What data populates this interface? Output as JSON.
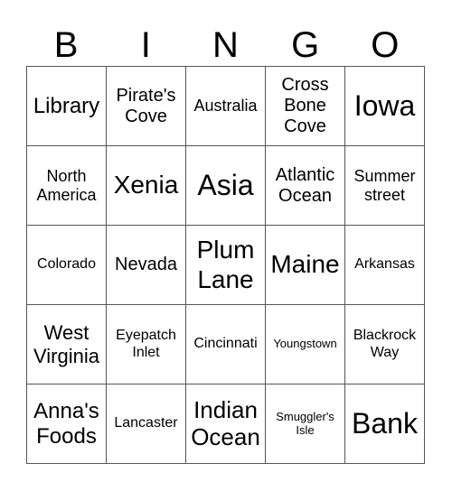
{
  "header": [
    "B",
    "I",
    "N",
    "G",
    "O"
  ],
  "cells": [
    {
      "text": "Library",
      "size": "s24"
    },
    {
      "text": "Pirate's\nCove",
      "size": "s20"
    },
    {
      "text": "Australia",
      "size": "s18"
    },
    {
      "text": "Cross\nBone\nCove",
      "size": "s20"
    },
    {
      "text": "Iowa",
      "size": "s32"
    },
    {
      "text": "North\nAmerica",
      "size": "s18"
    },
    {
      "text": "Xenia",
      "size": "s28"
    },
    {
      "text": "Asia",
      "size": "s32"
    },
    {
      "text": "Atlantic\nOcean",
      "size": "s20"
    },
    {
      "text": "Summer\nstreet",
      "size": "s18"
    },
    {
      "text": "Colorado",
      "size": "s16"
    },
    {
      "text": "Nevada",
      "size": "s20"
    },
    {
      "text": "Plum\nLane",
      "size": "s28"
    },
    {
      "text": "Maine",
      "size": "s28"
    },
    {
      "text": "Arkansas",
      "size": "s16"
    },
    {
      "text": "West\nVirginia",
      "size": "s22"
    },
    {
      "text": "Eyepatch\nInlet",
      "size": "s16"
    },
    {
      "text": "Cincinnati",
      "size": "s16"
    },
    {
      "text": "Youngstown",
      "size": "s13"
    },
    {
      "text": "Blackrock\nWay",
      "size": "s16"
    },
    {
      "text": "Anna's\nFoods",
      "size": "s24"
    },
    {
      "text": "Lancaster",
      "size": "s16"
    },
    {
      "text": "Indian\nOcean",
      "size": "s26"
    },
    {
      "text": "Smuggler's\nIsle",
      "size": "s13"
    },
    {
      "text": "Bank",
      "size": "s32"
    }
  ]
}
